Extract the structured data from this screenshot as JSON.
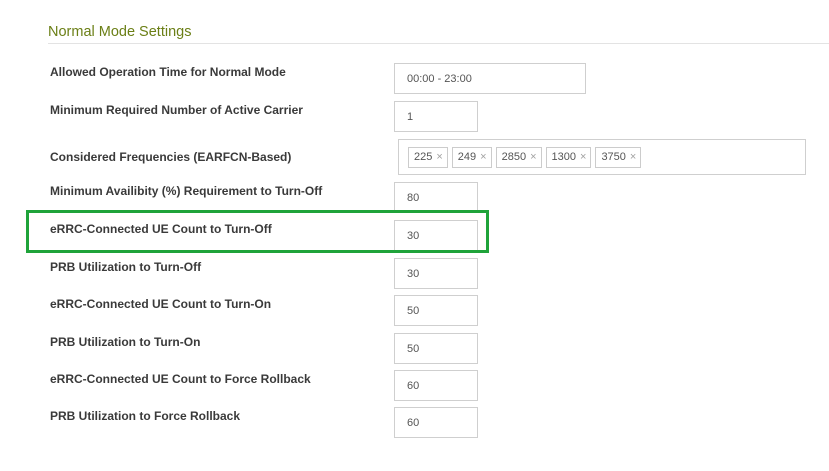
{
  "section": {
    "title": "Normal Mode Settings"
  },
  "settings": [
    {
      "label": "Allowed Operation Time for Normal Mode",
      "value": "00:00 - 23:00"
    },
    {
      "label": "Minimum Required Number of Active Carrier",
      "value": "1"
    },
    {
      "label": "Considered Frequencies (EARFCN-Based)",
      "tags": [
        "225",
        "249",
        "2850",
        "1300",
        "3750"
      ]
    },
    {
      "label": "Minimum Availibity (%) Requirement to Turn-Off",
      "value": "80"
    },
    {
      "label": "eRRC-Connected UE Count to Turn-Off",
      "value": "30"
    },
    {
      "label": "PRB Utilization to Turn-Off",
      "value": "30"
    },
    {
      "label": "eRRC-Connected UE Count to Turn-On",
      "value": "50"
    },
    {
      "label": "PRB Utilization to Turn-On",
      "value": "50"
    },
    {
      "label": "eRRC-Connected UE Count to Force Rollback",
      "value": "60"
    },
    {
      "label": "PRB Utilization to Force Rollback",
      "value": "60"
    }
  ],
  "tag_remove_glyph": "×",
  "colors": {
    "section_title": "#6b7f16",
    "highlight": "#1fa33a"
  }
}
